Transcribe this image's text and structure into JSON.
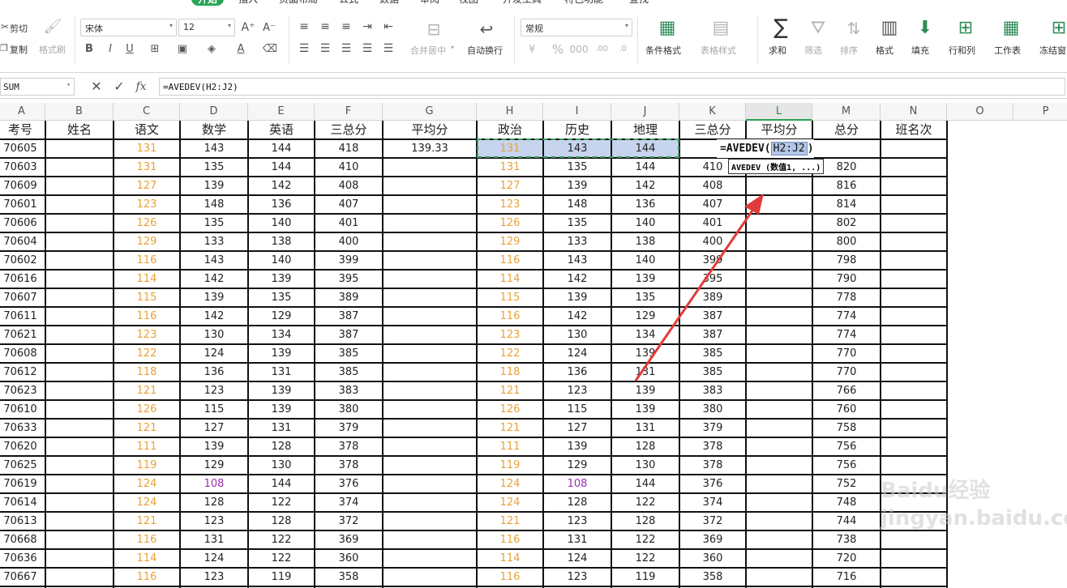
{
  "menu": [
    "开始",
    "插入",
    "页面布局",
    "公式",
    "数据",
    "审阅",
    "视图",
    "开发工具",
    "特色功能",
    "查找"
  ],
  "ribbon": {
    "cut": "剪切",
    "copy": "复制",
    "format_painter": "格式刷",
    "font_name": "宋体",
    "font_size": "12",
    "merge_center": "合并居中",
    "wrap_text": "自动换行",
    "number_format": "常规",
    "conditional_format": "条件格式",
    "table_style": "表格样式",
    "sum": "求和",
    "filter": "筛选",
    "sort": "排序",
    "format": "格式",
    "fill": "填充",
    "row_col": "行和列",
    "worksheet": "工作表",
    "freeze": "冻结窗"
  },
  "formula_bar": {
    "name_box": "SUM",
    "fx_label": "fx",
    "formula": "=AVEDEV(H2:J2)"
  },
  "editing": {
    "prefix": "=AVEDEV(",
    "ref": "H2:J2",
    "suffix": ")",
    "tooltip": "AVEDEV (数值1, ...)"
  },
  "columns": [
    "A",
    "B",
    "C",
    "D",
    "E",
    "F",
    "G",
    "H",
    "I",
    "J",
    "K",
    "L",
    "M",
    "N",
    "O",
    "P"
  ],
  "header_row": [
    "考号",
    "姓名",
    "语文",
    "数学",
    "英语",
    "三总分",
    "平均分",
    "政治",
    "历史",
    "地理",
    "三总分",
    "平均分",
    "总分",
    "班名次"
  ],
  "rows": [
    [
      "70605",
      "",
      "131",
      "143",
      "144",
      "418",
      "139.33",
      "131",
      "143",
      "144",
      "",
      "",
      "",
      ""
    ],
    [
      "70603",
      "",
      "131",
      "135",
      "144",
      "410",
      "",
      "131",
      "135",
      "144",
      "410",
      "",
      "820",
      ""
    ],
    [
      "70609",
      "",
      "127",
      "139",
      "142",
      "408",
      "",
      "127",
      "139",
      "142",
      "408",
      "",
      "816",
      ""
    ],
    [
      "70601",
      "",
      "123",
      "148",
      "136",
      "407",
      "",
      "123",
      "148",
      "136",
      "407",
      "",
      "814",
      ""
    ],
    [
      "70606",
      "",
      "126",
      "135",
      "140",
      "401",
      "",
      "126",
      "135",
      "140",
      "401",
      "",
      "802",
      ""
    ],
    [
      "70604",
      "",
      "129",
      "133",
      "138",
      "400",
      "",
      "129",
      "133",
      "138",
      "400",
      "",
      "800",
      ""
    ],
    [
      "70602",
      "",
      "116",
      "143",
      "140",
      "399",
      "",
      "116",
      "143",
      "140",
      "399",
      "",
      "798",
      ""
    ],
    [
      "70616",
      "",
      "114",
      "142",
      "139",
      "395",
      "",
      "114",
      "142",
      "139",
      "395",
      "",
      "790",
      ""
    ],
    [
      "70607",
      "",
      "115",
      "139",
      "135",
      "389",
      "",
      "115",
      "139",
      "135",
      "389",
      "",
      "778",
      ""
    ],
    [
      "70611",
      "",
      "116",
      "142",
      "129",
      "387",
      "",
      "116",
      "142",
      "129",
      "387",
      "",
      "774",
      ""
    ],
    [
      "70621",
      "",
      "123",
      "130",
      "134",
      "387",
      "",
      "123",
      "130",
      "134",
      "387",
      "",
      "774",
      ""
    ],
    [
      "70608",
      "",
      "122",
      "124",
      "139",
      "385",
      "",
      "122",
      "124",
      "139",
      "385",
      "",
      "770",
      ""
    ],
    [
      "70612",
      "",
      "118",
      "136",
      "131",
      "385",
      "",
      "118",
      "136",
      "131",
      "385",
      "",
      "770",
      ""
    ],
    [
      "70623",
      "",
      "121",
      "123",
      "139",
      "383",
      "",
      "121",
      "123",
      "139",
      "383",
      "",
      "766",
      ""
    ],
    [
      "70610",
      "",
      "126",
      "115",
      "139",
      "380",
      "",
      "126",
      "115",
      "139",
      "380",
      "",
      "760",
      ""
    ],
    [
      "70633",
      "",
      "121",
      "127",
      "131",
      "379",
      "",
      "121",
      "127",
      "131",
      "379",
      "",
      "758",
      ""
    ],
    [
      "70620",
      "",
      "111",
      "139",
      "128",
      "378",
      "",
      "111",
      "139",
      "128",
      "378",
      "",
      "756",
      ""
    ],
    [
      "70625",
      "",
      "119",
      "129",
      "130",
      "378",
      "",
      "119",
      "129",
      "130",
      "378",
      "",
      "756",
      ""
    ],
    [
      "70619",
      "",
      "124",
      "108",
      "144",
      "376",
      "",
      "124",
      "108",
      "144",
      "376",
      "",
      "752",
      ""
    ],
    [
      "70614",
      "",
      "124",
      "128",
      "122",
      "374",
      "",
      "124",
      "128",
      "122",
      "374",
      "",
      "748",
      ""
    ],
    [
      "70613",
      "",
      "121",
      "123",
      "128",
      "372",
      "",
      "121",
      "123",
      "128",
      "372",
      "",
      "744",
      ""
    ],
    [
      "70668",
      "",
      "116",
      "131",
      "122",
      "369",
      "",
      "116",
      "131",
      "122",
      "369",
      "",
      "738",
      ""
    ],
    [
      "70636",
      "",
      "114",
      "124",
      "122",
      "360",
      "",
      "114",
      "124",
      "122",
      "360",
      "",
      "720",
      ""
    ],
    [
      "70667",
      "",
      "116",
      "123",
      "119",
      "358",
      "",
      "116",
      "123",
      "119",
      "358",
      "",
      "716",
      ""
    ]
  ],
  "colors": {
    "orange_text": "#e8a13a",
    "purple_text": "#9b2fb0",
    "accent_green": "#27a454",
    "annotation_arrow": "#e23b3b",
    "selection": "#b4c6e7"
  },
  "watermark": "Baidu经验 jingyan.baidu.com"
}
